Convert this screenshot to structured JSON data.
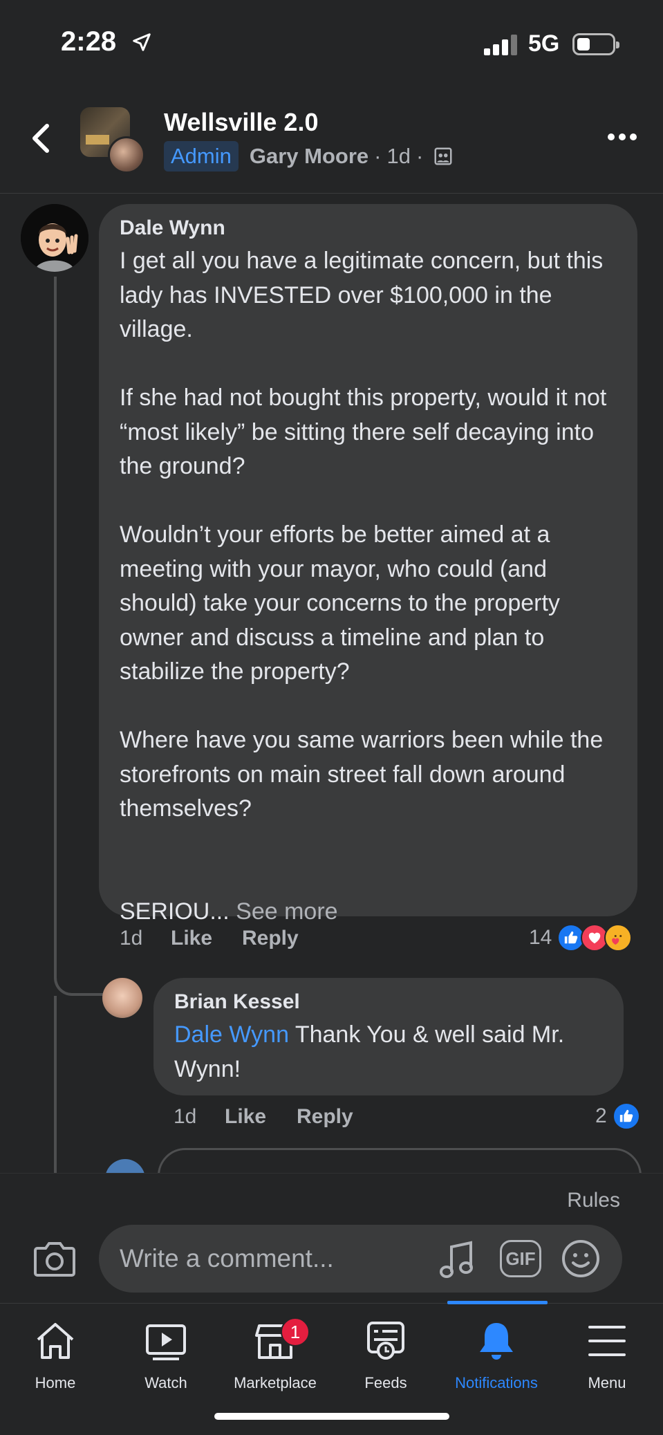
{
  "status_bar": {
    "time": "2:28",
    "network": "5G"
  },
  "header": {
    "group_name": "Wellsville 2.0",
    "role_badge": "Admin",
    "author": "Gary Moore",
    "time": "1d",
    "separator": "·"
  },
  "comments": [
    {
      "author": "Dale Wynn",
      "text": "I get all you have a legitimate concern, but this lady has INVESTED over $100,000 in the village.\n\nIf she had not bought this property, would it not “most likely” be sitting there self decaying into the ground?\n\nWouldn’t your efforts be better aimed at a meeting with your mayor, who could (and should) take your concerns to the property owner and discuss a timeline and plan to stabilize the property?\n\nWhere have you same warriors been while the storefronts on main street fall down around themselves?\n\n\nSERIOU... ",
      "see_more": "See more",
      "time": "1d",
      "like_label": "Like",
      "reply_label": "Reply",
      "reaction_count": "14",
      "reactions": [
        "like",
        "love",
        "care"
      ]
    },
    {
      "author": "Brian Kessel",
      "mention": "Dale Wynn",
      "text": " Thank You & well said Mr. Wynn!",
      "time": "1d",
      "like_label": "Like",
      "reply_label": "Reply",
      "reaction_count": "2",
      "reactions": [
        "like"
      ]
    }
  ],
  "composer": {
    "rules_label": "Rules",
    "placeholder": "Write a comment...",
    "gif_label": "GIF"
  },
  "bottom_nav": {
    "items": [
      {
        "label": "Home",
        "icon": "home-icon"
      },
      {
        "label": "Watch",
        "icon": "watch-icon"
      },
      {
        "label": "Marketplace",
        "icon": "marketplace-icon",
        "badge": "1"
      },
      {
        "label": "Feeds",
        "icon": "feeds-icon"
      },
      {
        "label": "Notifications",
        "icon": "bell-icon",
        "active": true
      },
      {
        "label": "Menu",
        "icon": "menu-icon"
      }
    ]
  },
  "colors": {
    "accent": "#2d88ff",
    "background": "#242526",
    "bubble": "#3a3b3c",
    "badge": "#e41e3f"
  }
}
